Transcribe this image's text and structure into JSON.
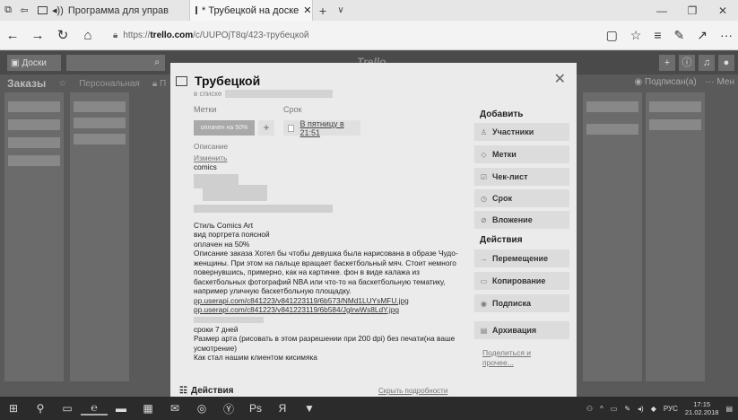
{
  "browser": {
    "tabs": [
      {
        "label": "Программа для управ",
        "active": false
      },
      {
        "label": "* Трубецкой на доске",
        "active": true
      }
    ],
    "new_tab": "+",
    "tab_menu": "∨",
    "url_host": "trello.com",
    "url_prefix": "https://",
    "url_path": "/c/UUPOjT8q/423-трубецкой"
  },
  "trello": {
    "boards_label": "Доски",
    "logo": "Trello",
    "board_name": "Заказы",
    "board_team": "Персональная",
    "board_cut": "П",
    "subscribed": "Подписан(а)",
    "menu": "Мен"
  },
  "card": {
    "title": "Трубецкой",
    "in_list": "в списке",
    "labels_header": "Метки",
    "due_header": "Срок",
    "label_chip": "оплачен на 50%",
    "add_label": "+",
    "due_text": "В пятницу в 21:51",
    "desc_header": "Описание",
    "edit_link": "Изменить",
    "desc_first": "comics",
    "desc_lines": [
      "Стиль Comics Art",
      "вид портрета поясной",
      "оплачен на 50%",
      "Описание заказа Хотел бы чтобы девушка была нарисована в образе Чудо-",
      "женщины. При этом на пальце вращает баскетбольный мяч. Стоит немного",
      "повернувшись, примерно, как на картинке. фон в виде калажа из",
      "баскетбольных фотографий NBA или что-то на баскетбольную тематику,",
      "например уличную баскетбольную площадку."
    ],
    "link1": "pp.userapi.com/c841223/v841223119/6b573/NMd1LUYsMFU.jpg",
    "link2": "pp.userapi.com/c841223/v841223119/6b584/JglrwWs8LdY.jpg",
    "desc_tail": [
      "сроки 7 дней",
      "Размер арта (рисовать в этом разрешении при 200 dpi) без печати(на ваше",
      "усмотрение)",
      "Как стал нашим клиентом кисимяка"
    ],
    "actions_label": "Действия",
    "hide_details": "Скрыть подробности"
  },
  "sidebar": {
    "add_header": "Добавить",
    "add_buttons": [
      {
        "label": "Участники",
        "icon": "person-icon"
      },
      {
        "label": "Метки",
        "icon": "tag-icon"
      },
      {
        "label": "Чек-лист",
        "icon": "checklist-icon"
      },
      {
        "label": "Срок",
        "icon": "clock-icon"
      },
      {
        "label": "Вложение",
        "icon": "paperclip-icon"
      }
    ],
    "actions_header": "Действия",
    "action_buttons": [
      {
        "label": "Перемещение",
        "icon": "arrow-right-icon"
      },
      {
        "label": "Копирование",
        "icon": "copy-icon"
      },
      {
        "label": "Подписка",
        "icon": "eye-icon"
      },
      {
        "label": "Архивация",
        "icon": "archive-icon"
      }
    ],
    "share": "Поделиться и",
    "more": "прочее..."
  },
  "taskbar": {
    "lang": "РУС",
    "time": "17:15",
    "date": "21.02.2018"
  }
}
